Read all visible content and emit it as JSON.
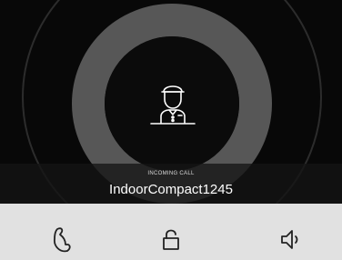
{
  "call": {
    "status_label": "INCOMING CALL",
    "caller_name": "IndoorCompact1245",
    "caller_icon": "concierge-icon"
  },
  "toolbar": {
    "buttons": [
      {
        "name": "answer",
        "icon": "phone-handset-icon"
      },
      {
        "name": "unlock",
        "icon": "unlock-icon"
      },
      {
        "name": "speaker",
        "icon": "speaker-icon"
      }
    ]
  },
  "colors": {
    "background": "#080808",
    "ring": "#575757",
    "toolbar": "#e1e1e1",
    "icon": "#222222",
    "text": "#ffffff"
  }
}
